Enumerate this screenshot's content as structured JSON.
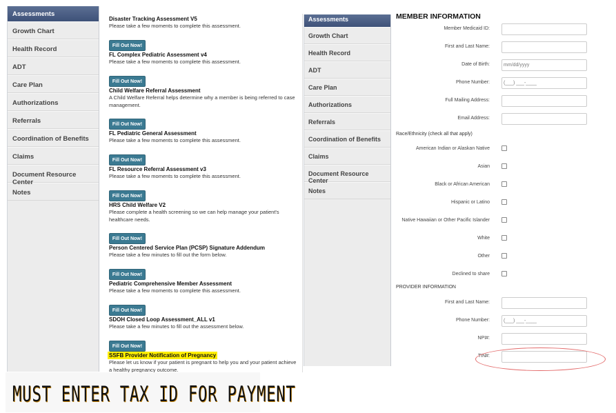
{
  "sidebar": {
    "header": "Assessments",
    "items": [
      "Growth Chart",
      "Health Record",
      "ADT",
      "Care Plan",
      "Authorizations",
      "Referrals",
      "Coordination of Benefits",
      "Claims",
      "Document Resource Center",
      "Notes"
    ]
  },
  "assessments": [
    {
      "title": "Disaster Tracking Assessment V5",
      "desc": "Please take a few moments to complete this assessment.",
      "button": "Fill Out Now!"
    },
    {
      "title": "FL Complex Pediatric Assessment v4",
      "desc": "Please take a few moments to complete this assessment.",
      "button": "Fill Out Now!"
    },
    {
      "title": "Child Welfare Referral Assessment",
      "desc": "A Child Welfare Referral helps determine why a member is being referred to case management.",
      "button": "Fill Out Now!"
    },
    {
      "title": "FL Pediatric General Assessment",
      "desc": "Please take a few moments to complete this assessment.",
      "button": "Fill Out Now!"
    },
    {
      "title": "FL Resource Referral Assessment v3",
      "desc": "Please take a few moments to complete this assessment.",
      "button": "Fill Out Now!"
    },
    {
      "title": "HRS Child Welfare V2",
      "desc": "Please complete a health screening so we can help manage your patient's healthcare needs.",
      "button": "Fill Out Now!"
    },
    {
      "title": "Person Centered Service Plan (PCSP) Signature Addendum",
      "desc": "Please take a few minutes to fill out the form below.",
      "button": "Fill Out Now!"
    },
    {
      "title": "Pediatric Comprehensive Member Assessment",
      "desc": "Please take a few moments to complete this assessment.",
      "button": "Fill Out Now!"
    },
    {
      "title": "SDOH Closed Loop Assessment_ALL v1",
      "desc": "Please take a few minutes to fill out the assessment below.",
      "button": "Fill Out Now!"
    },
    {
      "title": "SSFB Provider Notification of Pregnancy",
      "desc": "Please let us know if your patient is pregnant to help you and your patient achieve a healthy pregnancy outcome."
    }
  ],
  "form": {
    "title": "MEMBER INFORMATION",
    "member_fields": [
      {
        "label": "Member Medicaid ID:",
        "value": ""
      },
      {
        "label": "First and Last Name:",
        "value": ""
      },
      {
        "label": "Date of Birth:",
        "value": "mm/dd/yyyy"
      },
      {
        "label": "Phone Number:",
        "value": "(___) ___-____"
      },
      {
        "label": "Full Mailing Address:",
        "value": ""
      },
      {
        "label": "Email Address:",
        "value": ""
      }
    ],
    "race_label": "Race/Ethnicity (check all that apply)",
    "race_options": [
      "American Indian or Alaskan Native",
      "Asian",
      "Black or African American",
      "Hispanic or Latino",
      "Native Hawaiian or Other Pacific Islander",
      "White",
      "Other",
      "Declined to share"
    ],
    "provider_title": "PROVIDER INFORMATION",
    "provider_fields": [
      {
        "label": "First and Last Name:",
        "value": ""
      },
      {
        "label": "Phone Number:",
        "value": "(___) ___-____"
      },
      {
        "label": "NPI#:",
        "value": ""
      },
      {
        "label": "TIN#:",
        "value": ""
      }
    ]
  },
  "annotation": {
    "banner": "MUST ENTER TAX ID FOR PAYMENT",
    "highlight_color": "#ffee00",
    "ellipse_color": "#e36a6a"
  }
}
